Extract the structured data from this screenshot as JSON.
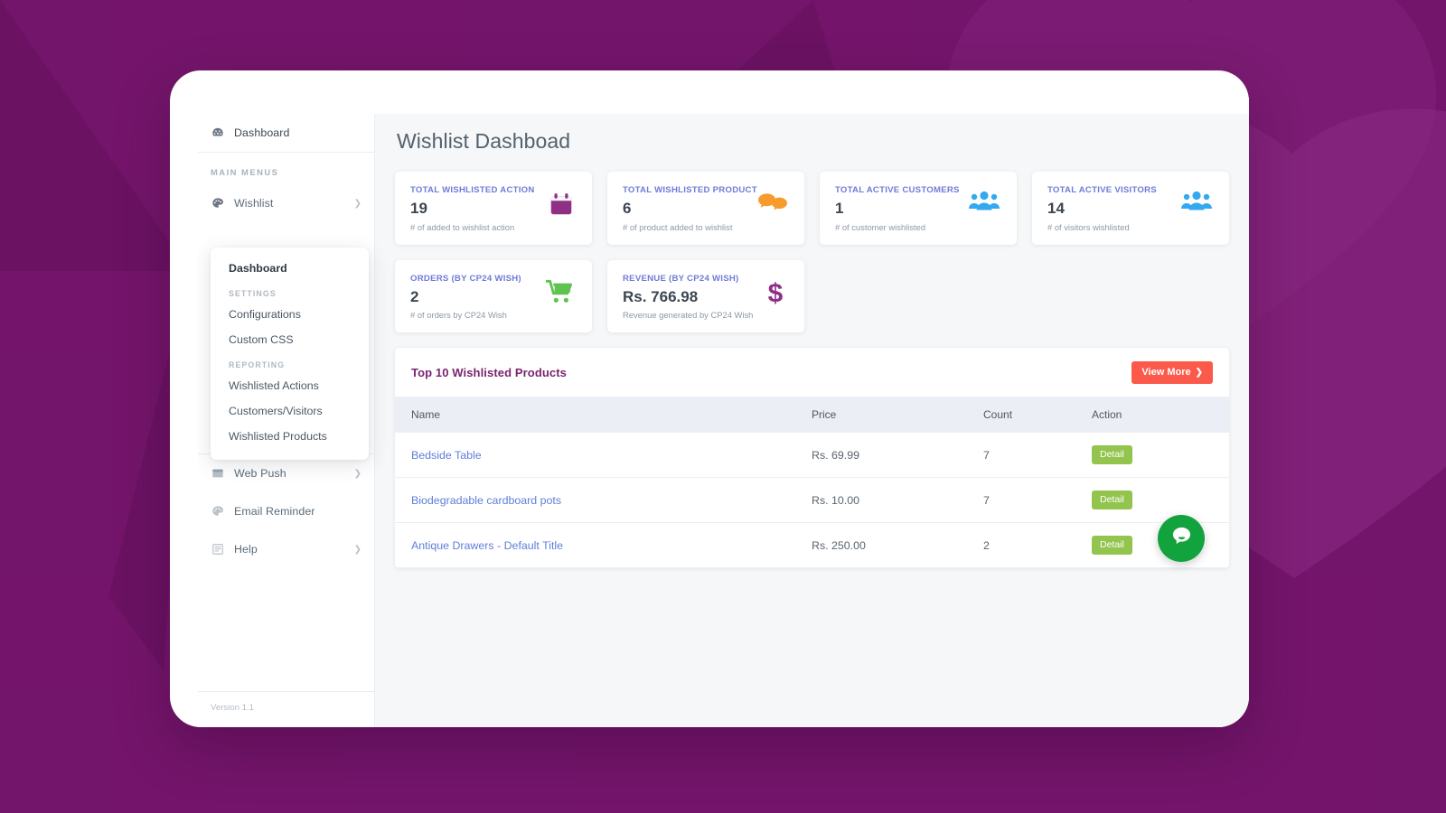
{
  "page": {
    "title": "Wishlist Dashboad",
    "version": "Version 1.1"
  },
  "colors": {
    "background": "#6b1263",
    "accent_label": "#6f7bd6",
    "panel_title": "#7a2470",
    "view_more_button": "#fb5a4b",
    "detail_button": "#92c44e",
    "chat_widget": "#12a23e",
    "link": "#5f7fd8"
  },
  "sidebar": {
    "top_item": {
      "label": "Dashboard",
      "icon": "tachometer-icon"
    },
    "section_heading": "MAIN MENUS",
    "items": [
      {
        "label": "Wishlist",
        "icon": "palette-icon",
        "expandable": true
      },
      {
        "label": "Web Push",
        "icon": "window-icon",
        "expandable": true
      },
      {
        "label": "Email Reminder",
        "icon": "palette-icon",
        "expandable": false
      },
      {
        "label": "Help",
        "icon": "book-list-icon",
        "expandable": true
      }
    ],
    "submenu": {
      "dashboard_label": "Dashboard",
      "settings_heading": "SETTINGS",
      "settings_items": [
        "Configurations",
        "Custom CSS"
      ],
      "reporting_heading": "REPORTING",
      "reporting_items": [
        "Wishlisted Actions",
        "Customers/Visitors",
        "Wishlisted Products"
      ]
    }
  },
  "stats": [
    {
      "label": "TOTAL WISHLISTED ACTION",
      "value": "19",
      "sub": "# of added to wishlist action",
      "icon": "calendar-icon",
      "icon_color": "#8f2f86"
    },
    {
      "label": "TOTAL WISHLISTED PRODUCT",
      "value": "6",
      "sub": "# of product added to wishlist",
      "icon": "chat-bubbles-icon",
      "icon_color": "#f79b2c"
    },
    {
      "label": "TOTAL ACTIVE CUSTOMERS",
      "value": "1",
      "sub": "# of customer wishlisted",
      "icon": "users-icon",
      "icon_color": "#34a9ef"
    },
    {
      "label": "TOTAL ACTIVE VISITORS",
      "value": "14",
      "sub": "# of visitors wishlisted",
      "icon": "users-icon",
      "icon_color": "#34a9ef"
    },
    {
      "label": "ORDERS (BY CP24 WISH)",
      "value": "2",
      "sub": "# of orders by CP24 Wish",
      "icon": "shopping-cart-icon",
      "icon_color": "#5fc352"
    },
    {
      "label": "REVENUE (BY CP24 WISH)",
      "value": "Rs. 766.98",
      "sub": "Revenue generated by CP24 Wish",
      "icon": "dollar-sign-icon",
      "icon_color": "#8f2f86"
    }
  ],
  "table": {
    "title": "Top 10 Wishlisted Products",
    "view_more_label": "View More",
    "view_more_chevron": "❯",
    "columns": [
      "Name",
      "Price",
      "Count",
      "Action"
    ],
    "rows": [
      {
        "name": "Bedside Table",
        "price": "Rs. 69.99",
        "count": "7",
        "action": "Detail"
      },
      {
        "name": "Biodegradable cardboard pots",
        "price": "Rs. 10.00",
        "count": "7",
        "action": "Detail"
      },
      {
        "name": "Antique Drawers - Default Title",
        "price": "Rs. 250.00",
        "count": "2",
        "action": "Detail"
      }
    ]
  },
  "chat_widget": {
    "icon": "chat-bubble-icon"
  }
}
